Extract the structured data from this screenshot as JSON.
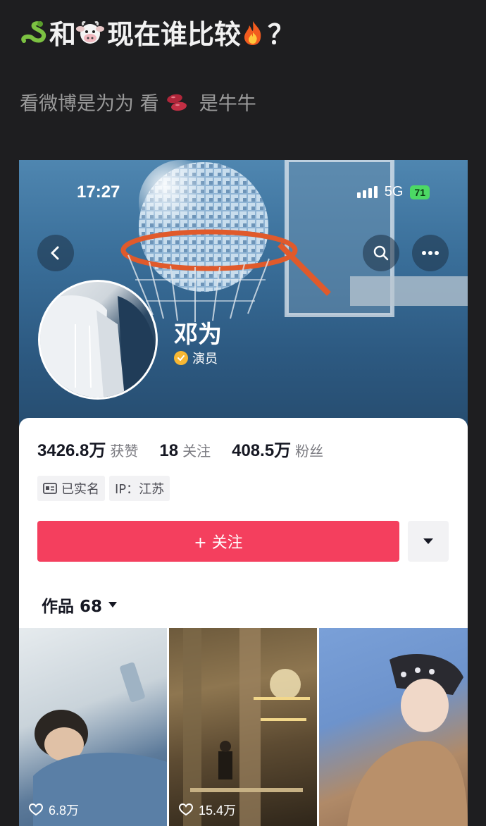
{
  "post": {
    "title": "和  现在谁比较 ？",
    "title_parts": [
      "和",
      "现在谁比较",
      "？"
    ],
    "body_parts": [
      "看微博是为为 看",
      "是牛牛"
    ],
    "emojis": [
      "snake-emoji",
      "cow-face-emoji",
      "fire-emoji",
      "beans-emoji"
    ]
  },
  "status_bar": {
    "time": "17:27",
    "network": "5G",
    "battery": "71"
  },
  "profile": {
    "name": "邓为",
    "verification": "演员",
    "stats": [
      {
        "value": "3426.8万",
        "label": "获赞"
      },
      {
        "value": "18",
        "label": "关注"
      },
      {
        "value": "408.5万",
        "label": "粉丝"
      }
    ],
    "tags": [
      {
        "icon": "id-card-icon",
        "text": "已实名"
      },
      {
        "icon": "",
        "text": "IP：江苏"
      }
    ],
    "follow_label": "+ 关注",
    "works_label": "作品 68",
    "videos": [
      {
        "likes": "6.8万"
      },
      {
        "likes": "15.4万"
      },
      {
        "likes": ""
      }
    ]
  },
  "colors": {
    "follow_button": "#f43f5e",
    "verify_badge": "#f7b733",
    "battery": "#4cd964"
  }
}
